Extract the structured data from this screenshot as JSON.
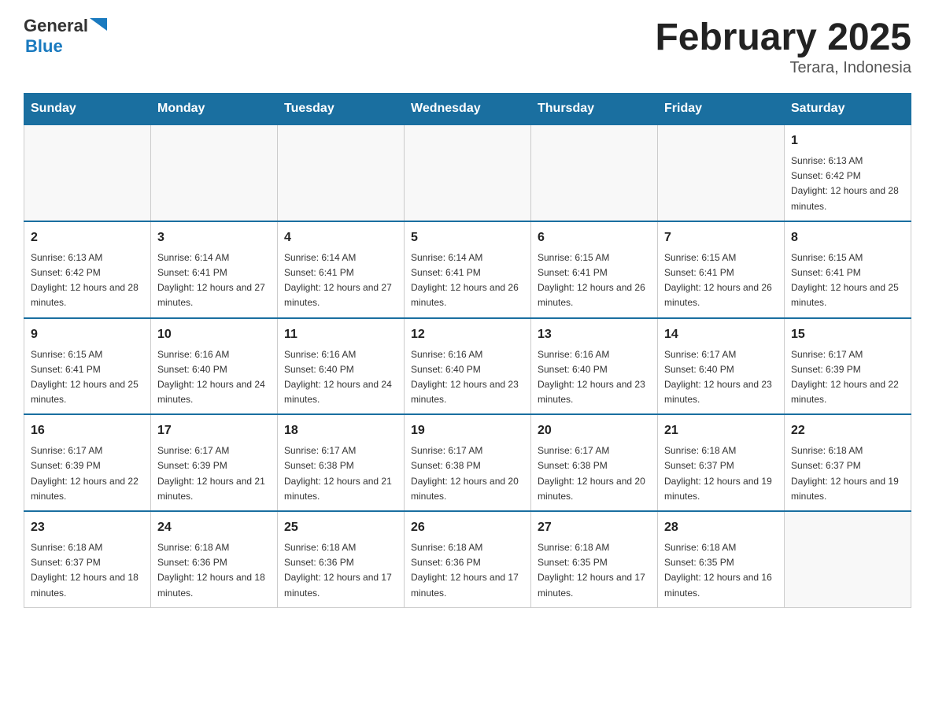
{
  "header": {
    "logo": {
      "general": "General",
      "blue": "Blue",
      "arrow": "▶"
    },
    "title": "February 2025",
    "subtitle": "Terara, Indonesia"
  },
  "weekdays": [
    "Sunday",
    "Monday",
    "Tuesday",
    "Wednesday",
    "Thursday",
    "Friday",
    "Saturday"
  ],
  "weeks": [
    [
      {
        "day": "",
        "info": ""
      },
      {
        "day": "",
        "info": ""
      },
      {
        "day": "",
        "info": ""
      },
      {
        "day": "",
        "info": ""
      },
      {
        "day": "",
        "info": ""
      },
      {
        "day": "",
        "info": ""
      },
      {
        "day": "1",
        "info": "Sunrise: 6:13 AM\nSunset: 6:42 PM\nDaylight: 12 hours and 28 minutes."
      }
    ],
    [
      {
        "day": "2",
        "info": "Sunrise: 6:13 AM\nSunset: 6:42 PM\nDaylight: 12 hours and 28 minutes."
      },
      {
        "day": "3",
        "info": "Sunrise: 6:14 AM\nSunset: 6:41 PM\nDaylight: 12 hours and 27 minutes."
      },
      {
        "day": "4",
        "info": "Sunrise: 6:14 AM\nSunset: 6:41 PM\nDaylight: 12 hours and 27 minutes."
      },
      {
        "day": "5",
        "info": "Sunrise: 6:14 AM\nSunset: 6:41 PM\nDaylight: 12 hours and 26 minutes."
      },
      {
        "day": "6",
        "info": "Sunrise: 6:15 AM\nSunset: 6:41 PM\nDaylight: 12 hours and 26 minutes."
      },
      {
        "day": "7",
        "info": "Sunrise: 6:15 AM\nSunset: 6:41 PM\nDaylight: 12 hours and 26 minutes."
      },
      {
        "day": "8",
        "info": "Sunrise: 6:15 AM\nSunset: 6:41 PM\nDaylight: 12 hours and 25 minutes."
      }
    ],
    [
      {
        "day": "9",
        "info": "Sunrise: 6:15 AM\nSunset: 6:41 PM\nDaylight: 12 hours and 25 minutes."
      },
      {
        "day": "10",
        "info": "Sunrise: 6:16 AM\nSunset: 6:40 PM\nDaylight: 12 hours and 24 minutes."
      },
      {
        "day": "11",
        "info": "Sunrise: 6:16 AM\nSunset: 6:40 PM\nDaylight: 12 hours and 24 minutes."
      },
      {
        "day": "12",
        "info": "Sunrise: 6:16 AM\nSunset: 6:40 PM\nDaylight: 12 hours and 23 minutes."
      },
      {
        "day": "13",
        "info": "Sunrise: 6:16 AM\nSunset: 6:40 PM\nDaylight: 12 hours and 23 minutes."
      },
      {
        "day": "14",
        "info": "Sunrise: 6:17 AM\nSunset: 6:40 PM\nDaylight: 12 hours and 23 minutes."
      },
      {
        "day": "15",
        "info": "Sunrise: 6:17 AM\nSunset: 6:39 PM\nDaylight: 12 hours and 22 minutes."
      }
    ],
    [
      {
        "day": "16",
        "info": "Sunrise: 6:17 AM\nSunset: 6:39 PM\nDaylight: 12 hours and 22 minutes."
      },
      {
        "day": "17",
        "info": "Sunrise: 6:17 AM\nSunset: 6:39 PM\nDaylight: 12 hours and 21 minutes."
      },
      {
        "day": "18",
        "info": "Sunrise: 6:17 AM\nSunset: 6:38 PM\nDaylight: 12 hours and 21 minutes."
      },
      {
        "day": "19",
        "info": "Sunrise: 6:17 AM\nSunset: 6:38 PM\nDaylight: 12 hours and 20 minutes."
      },
      {
        "day": "20",
        "info": "Sunrise: 6:17 AM\nSunset: 6:38 PM\nDaylight: 12 hours and 20 minutes."
      },
      {
        "day": "21",
        "info": "Sunrise: 6:18 AM\nSunset: 6:37 PM\nDaylight: 12 hours and 19 minutes."
      },
      {
        "day": "22",
        "info": "Sunrise: 6:18 AM\nSunset: 6:37 PM\nDaylight: 12 hours and 19 minutes."
      }
    ],
    [
      {
        "day": "23",
        "info": "Sunrise: 6:18 AM\nSunset: 6:37 PM\nDaylight: 12 hours and 18 minutes."
      },
      {
        "day": "24",
        "info": "Sunrise: 6:18 AM\nSunset: 6:36 PM\nDaylight: 12 hours and 18 minutes."
      },
      {
        "day": "25",
        "info": "Sunrise: 6:18 AM\nSunset: 6:36 PM\nDaylight: 12 hours and 17 minutes."
      },
      {
        "day": "26",
        "info": "Sunrise: 6:18 AM\nSunset: 6:36 PM\nDaylight: 12 hours and 17 minutes."
      },
      {
        "day": "27",
        "info": "Sunrise: 6:18 AM\nSunset: 6:35 PM\nDaylight: 12 hours and 17 minutes."
      },
      {
        "day": "28",
        "info": "Sunrise: 6:18 AM\nSunset: 6:35 PM\nDaylight: 12 hours and 16 minutes."
      },
      {
        "day": "",
        "info": ""
      }
    ]
  ]
}
